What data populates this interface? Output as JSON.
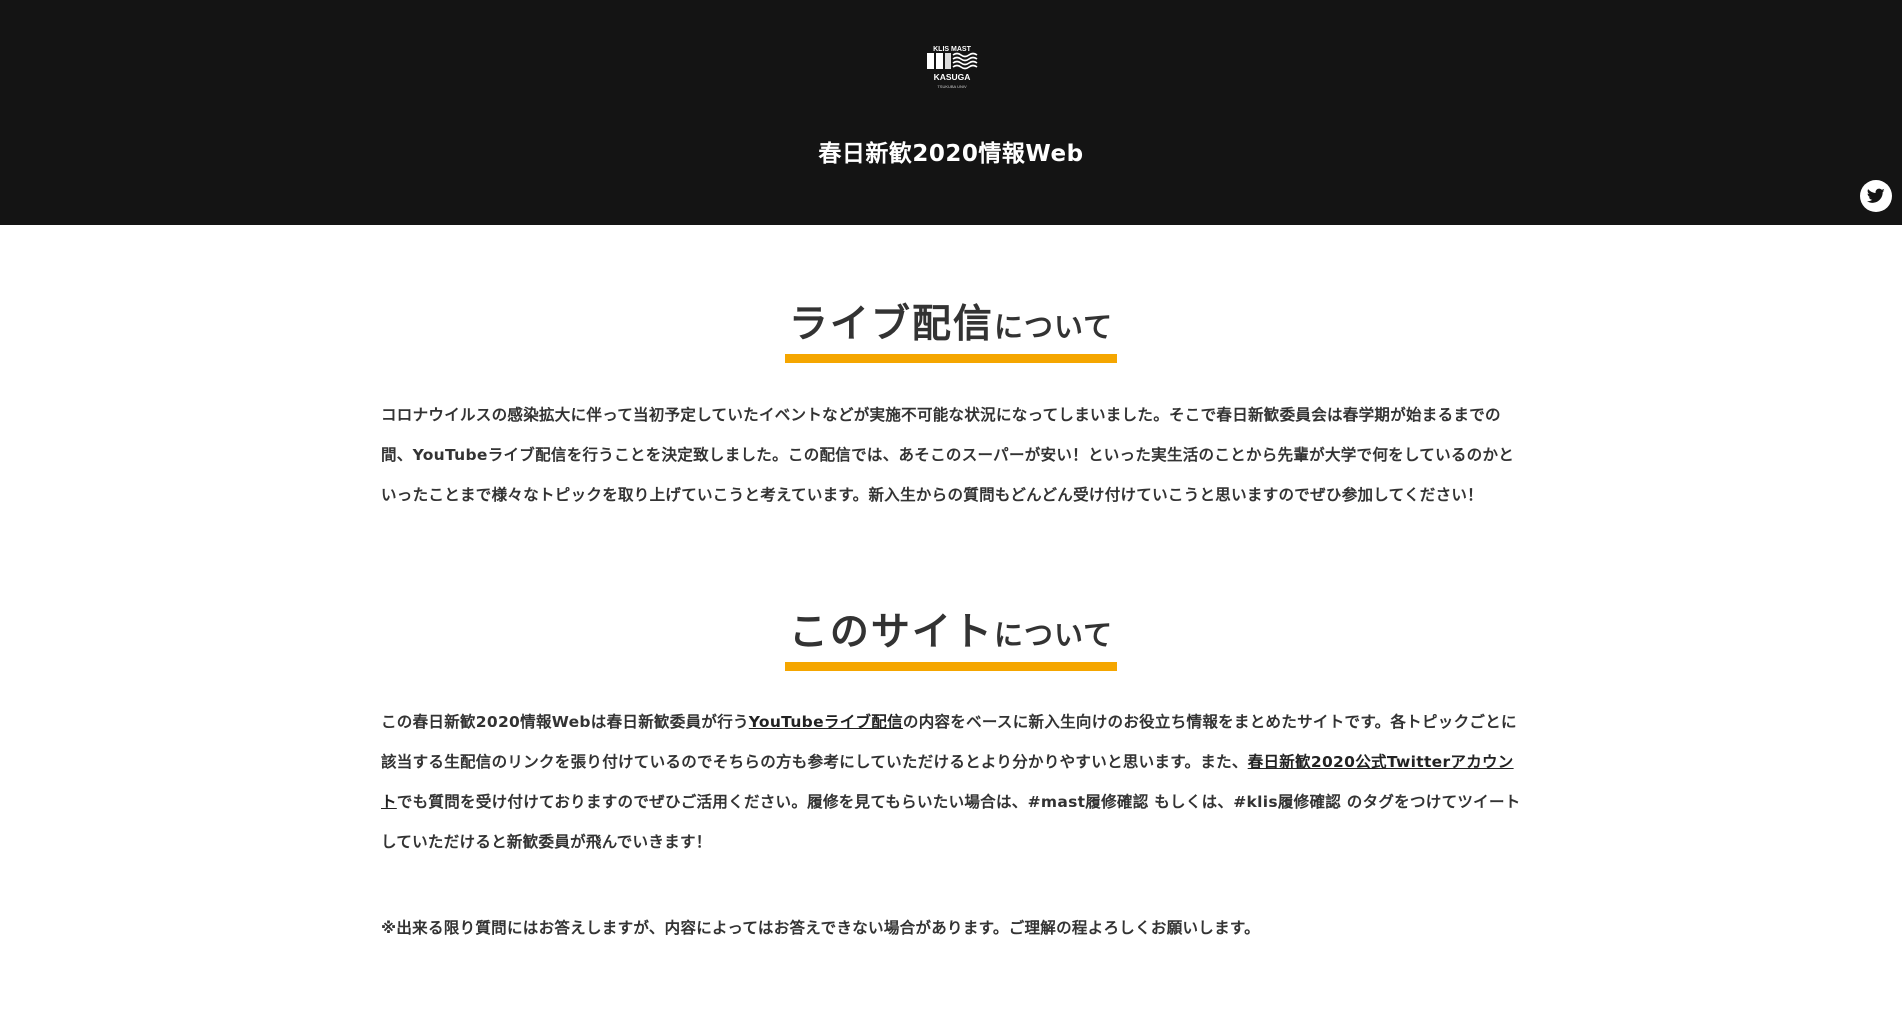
{
  "header": {
    "logo_text_top": "KLIS MAST",
    "logo_text_main": "KASUGA",
    "logo_text_sub": "TSUKUBA UNIV",
    "title": "春日新歓2020情報Web"
  },
  "colors": {
    "header_bg": "#141414",
    "accent": "#f5a600",
    "text": "#333333"
  },
  "social": {
    "twitter_icon": "twitter-icon"
  },
  "sections": [
    {
      "heading_main": "ライブ配信",
      "heading_suffix": "について",
      "paragraph": "コロナウイルスの感染拡大に伴って当初予定していたイベントなどが実施不可能な状況になってしまいました。そこで春日新歓委員会は春学期が始まるまでの間、YouTubeライブ配信を行うことを決定致しました。この配信では、あそこのスーパーが安い！といった実生活のことから先輩が大学で何をしているのかといったことまで様々なトピックを取り上げていこうと考えています。新入生からの質問もどんどん受け付けていこうと思いますのでぜひ参加してください！"
    },
    {
      "heading_main": "このサイト",
      "heading_suffix": "について",
      "p1_a": "この春日新歓2020情報Webは春日新歓委員が行う",
      "p1_link1": "YouTubeライブ配信",
      "p1_b": "の内容をベースに新入生向けのお役立ち情報をまとめたサイトです。各トピックごとに該当する生配信のリンクを張り付けているのでそちらの方も参考にしていただけるとより分かりやすいと思います。また、",
      "p1_link2": "春日新歓2020公式Twitterアカウント",
      "p1_c": "でも質問を受け付けておりますのでぜひご活用ください。履修を見てもらいたい場合は、",
      "p1_tag1": "#mast履修確認",
      "p1_d": " もしくは、",
      "p1_tag2": "#klis履修確認",
      "p1_e": " のタグをつけてツイートしていただけると新歓委員が飛んでいきます！",
      "p2": "※出来る限り質問にはお答えしますが、内容によってはお答えできない場合があります。ご理解の程よろしくお願いします。"
    }
  ]
}
